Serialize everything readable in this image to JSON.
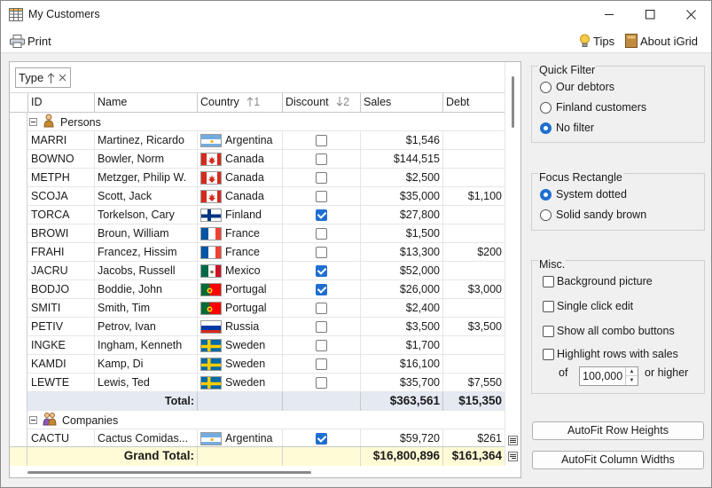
{
  "window": {
    "title": "My Customers",
    "accent": "#1f6fd1"
  },
  "toolbar": {
    "print_label": "Print",
    "tips_label": "Tips",
    "about_label": "About iGrid"
  },
  "grid": {
    "group_chip": {
      "label": "Type",
      "sort": "ascending"
    },
    "columns": [
      "ID",
      "Name",
      "Country",
      "Discount",
      "Sales",
      "Debt"
    ],
    "country_sort_index": "1",
    "discount_sort_index": "2",
    "groups": [
      {
        "label": "Persons",
        "rows": [
          {
            "id": "MARRI",
            "name": "Martinez, Ricardo",
            "country": "Argentina",
            "flag": "argentina",
            "discount": false,
            "sales": "$1,546",
            "debt": ""
          },
          {
            "id": "BOWNO",
            "name": "Bowler, Norm",
            "country": "Canada",
            "flag": "canada",
            "discount": false,
            "sales": "$144,515",
            "debt": ""
          },
          {
            "id": "METPH",
            "name": "Metzger, Philip W.",
            "country": "Canada",
            "flag": "canada",
            "discount": false,
            "sales": "$2,500",
            "debt": ""
          },
          {
            "id": "SCOJA",
            "name": "Scott, Jack",
            "country": "Canada",
            "flag": "canada",
            "discount": false,
            "sales": "$35,000",
            "debt": "$1,100"
          },
          {
            "id": "TORCA",
            "name": "Torkelson, Cary",
            "country": "Finland",
            "flag": "finland",
            "discount": true,
            "sales": "$27,800",
            "debt": ""
          },
          {
            "id": "BROWI",
            "name": "Broun, William",
            "country": "France",
            "flag": "france",
            "discount": false,
            "sales": "$1,500",
            "debt": ""
          },
          {
            "id": "FRAHI",
            "name": "Francez, Hissim",
            "country": "France",
            "flag": "france",
            "discount": false,
            "sales": "$13,300",
            "debt": "$200"
          },
          {
            "id": "JACRU",
            "name": "Jacobs, Russell",
            "country": "Mexico",
            "flag": "mexico",
            "discount": true,
            "sales": "$52,000",
            "debt": ""
          },
          {
            "id": "BODJO",
            "name": "Boddie, John",
            "country": "Portugal",
            "flag": "portugal",
            "discount": true,
            "sales": "$26,000",
            "debt": "$3,000"
          },
          {
            "id": "SMITI",
            "name": "Smith, Tim",
            "country": "Portugal",
            "flag": "portugal",
            "discount": false,
            "sales": "$2,400",
            "debt": ""
          },
          {
            "id": "PETIV",
            "name": "Petrov, Ivan",
            "country": "Russia",
            "flag": "russia",
            "discount": false,
            "sales": "$3,500",
            "debt": "$3,500"
          },
          {
            "id": "INGKE",
            "name": "Ingham, Kenneth",
            "country": "Sweden",
            "flag": "sweden",
            "discount": false,
            "sales": "$1,700",
            "debt": ""
          },
          {
            "id": "KAMDI",
            "name": "Kamp, Di",
            "country": "Sweden",
            "flag": "sweden",
            "discount": false,
            "sales": "$16,100",
            "debt": ""
          },
          {
            "id": "LEWTE",
            "name": "Lewis, Ted",
            "country": "Sweden",
            "flag": "sweden",
            "discount": false,
            "sales": "$35,700",
            "debt": "$7,550"
          }
        ],
        "total": {
          "label": "Total:",
          "sales": "$363,561",
          "debt": "$15,350"
        }
      },
      {
        "label": "Companies",
        "rows": [
          {
            "id": "CACTU",
            "name": "Cactus Comidas...",
            "country": "Argentina",
            "flag": "argentina",
            "discount": true,
            "sales": "$59,720",
            "debt": "$261"
          }
        ]
      }
    ],
    "grand_total": {
      "label": "Grand Total:",
      "sales": "$16,800,896",
      "debt": "$161,364"
    }
  },
  "quick_filter": {
    "title": "Quick Filter",
    "options": [
      "Our debtors",
      "Finland customers",
      "No filter"
    ],
    "selected_index": 2
  },
  "focus_rectangle": {
    "title": "Focus Rectangle",
    "options": [
      "System dotted",
      "Solid sandy brown"
    ],
    "selected_index": 0
  },
  "misc": {
    "title": "Misc.",
    "options": [
      {
        "label": "Background picture",
        "checked": false
      },
      {
        "label": "Single click edit",
        "checked": false
      },
      {
        "label": "Show all combo buttons",
        "checked": false
      },
      {
        "label": "Highlight rows with sales",
        "checked": false
      }
    ],
    "of_label": "of",
    "threshold_value": "100,000",
    "higher_label": "or higher"
  },
  "buttons": {
    "autofit_rows": "AutoFit Row Heights",
    "autofit_cols": "AutoFit Column Widths"
  }
}
